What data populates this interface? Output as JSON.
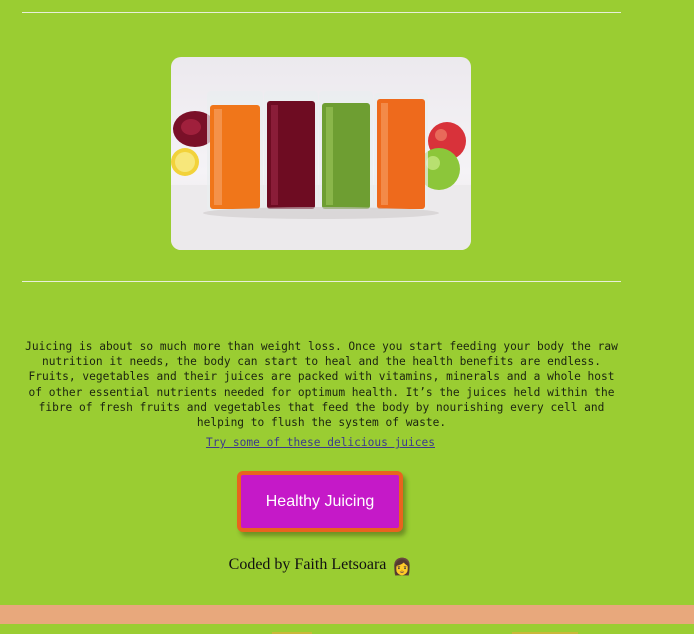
{
  "hero_image": {
    "description_icon": "juice-glasses-image"
  },
  "intro": {
    "text": "Juicing is about so much more than weight loss. Once you start feeding your body the raw nutrition it needs, the body can start to heal and the health benefits are endless. Fruits, vegetables and their juices are packed with vitamins, minerals and a whole host of other essential nutrients needed for optimum health. It’s the juices held within the fibre of fresh fruits and vegetables that feed the body by nourishing every cell and helping to flush the system of waste."
  },
  "link": {
    "label": "Try some of these delicious juices"
  },
  "cta": {
    "label": "Healthy Juicing"
  },
  "footer": {
    "credit": "Coded by Faith Letsoara",
    "emoji": "👩"
  },
  "colors": {
    "background": "#9acd32",
    "button": "#c519c8",
    "button_border": "#e8641e",
    "band": "#e8a87c"
  }
}
